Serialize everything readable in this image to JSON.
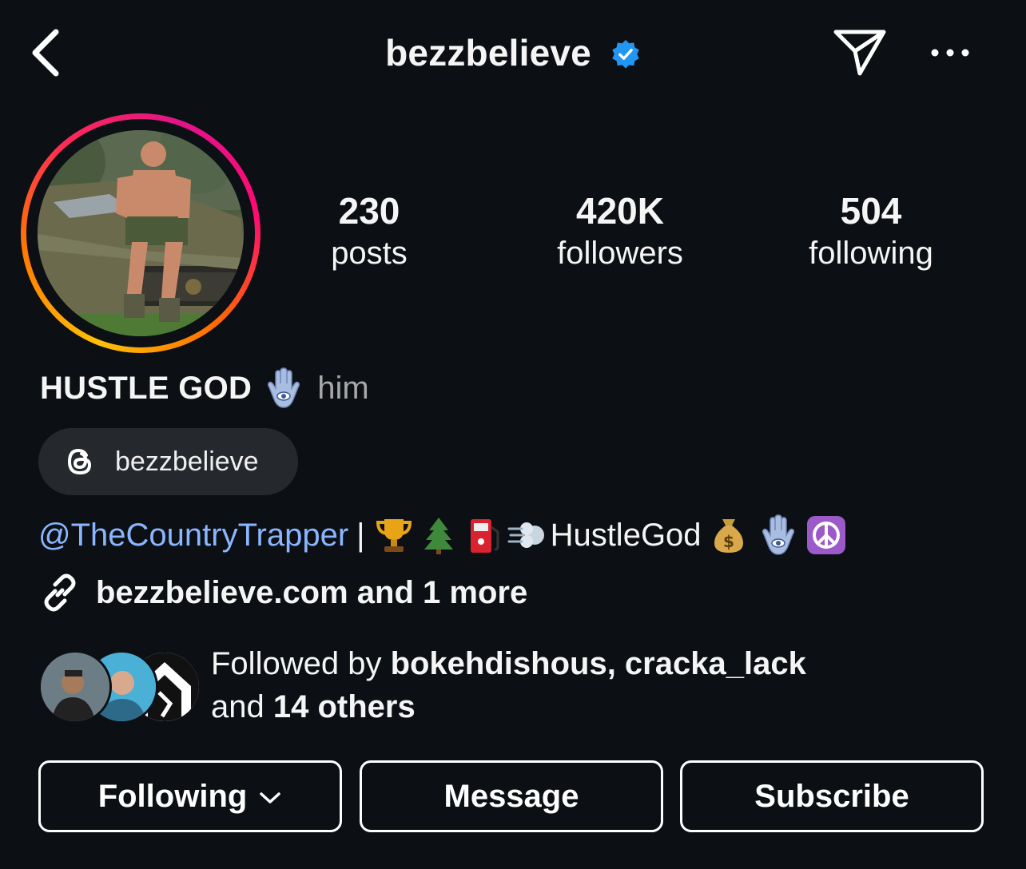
{
  "header": {
    "username": "bezzbelieve",
    "verified": true,
    "icons": [
      "chevron-left-icon",
      "verified-badge-icon",
      "send-icon",
      "more-icon"
    ]
  },
  "stats": [
    {
      "value": "230",
      "label": "posts"
    },
    {
      "value": "420K",
      "label": "followers"
    },
    {
      "value": "504",
      "label": "following"
    }
  ],
  "profile": {
    "name": "HUSTLE GOD",
    "pronouns": "him",
    "threads_handle": "bezzbelieve",
    "bio": {
      "mention": "@TheCountryTrapper",
      "separator": "|",
      "text": "HustleGod"
    },
    "link_text": "bezzbelieve.com and 1 more"
  },
  "followed_by": {
    "prefix": "Followed by ",
    "names": "bokehdishous, cracka_lack",
    "and": "and ",
    "others": "14 others"
  },
  "actions": {
    "following_label": "Following",
    "message_label": "Message",
    "subscribe_label": "Subscribe"
  },
  "colors": {
    "background": "#0c1014",
    "mention": "#8ab5ff",
    "verified": "#2196f3",
    "chip": "#25292e",
    "muted": "#a8a8a8"
  }
}
